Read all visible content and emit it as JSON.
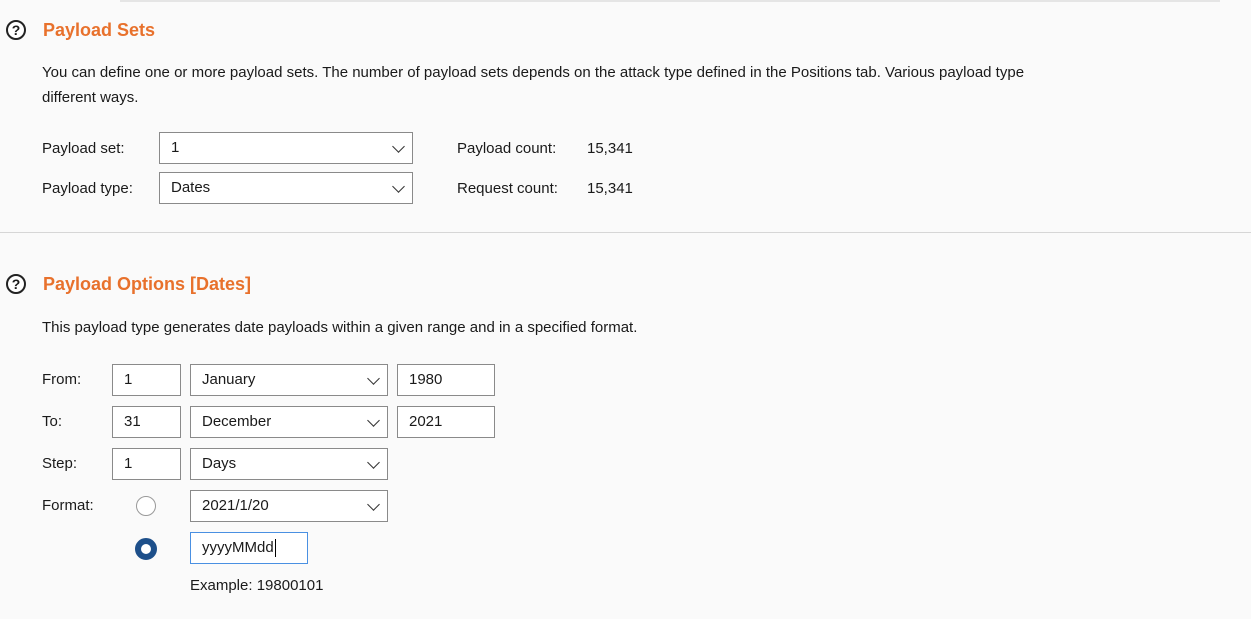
{
  "payload_sets": {
    "title": "Payload Sets",
    "description_line1": "You can define one or more payload sets. The number of payload sets depends on the attack type defined in the Positions tab. Various payload type",
    "description_line2": "different ways.",
    "payload_set_label": "Payload set:",
    "payload_set_value": "1",
    "payload_type_label": "Payload type:",
    "payload_type_value": "Dates",
    "payload_count_label": "Payload count:",
    "payload_count_value": "15,341",
    "request_count_label": "Request count:",
    "request_count_value": "15,341"
  },
  "payload_options": {
    "title": "Payload Options [Dates]",
    "description": "This payload type generates date payloads within a given range and in a specified format.",
    "from_label": "From:",
    "from_day": "1",
    "from_month": "January",
    "from_year": "1980",
    "to_label": "To:",
    "to_day": "31",
    "to_month": "December",
    "to_year": "2021",
    "step_label": "Step:",
    "step_value": "1",
    "step_unit": "Days",
    "format_label": "Format:",
    "format_preset": "2021/1/20",
    "format_custom": "yyyyMMdd",
    "format_custom_selected": true,
    "example_label": "Example:",
    "example_value": "19800101"
  },
  "icons": {
    "help": "help-question-icon",
    "dropdown": "chevron-down-icon"
  },
  "colors": {
    "title": "#e8712c",
    "radio_selected": "#1d4f8a",
    "focus_border": "#4a90e2"
  }
}
